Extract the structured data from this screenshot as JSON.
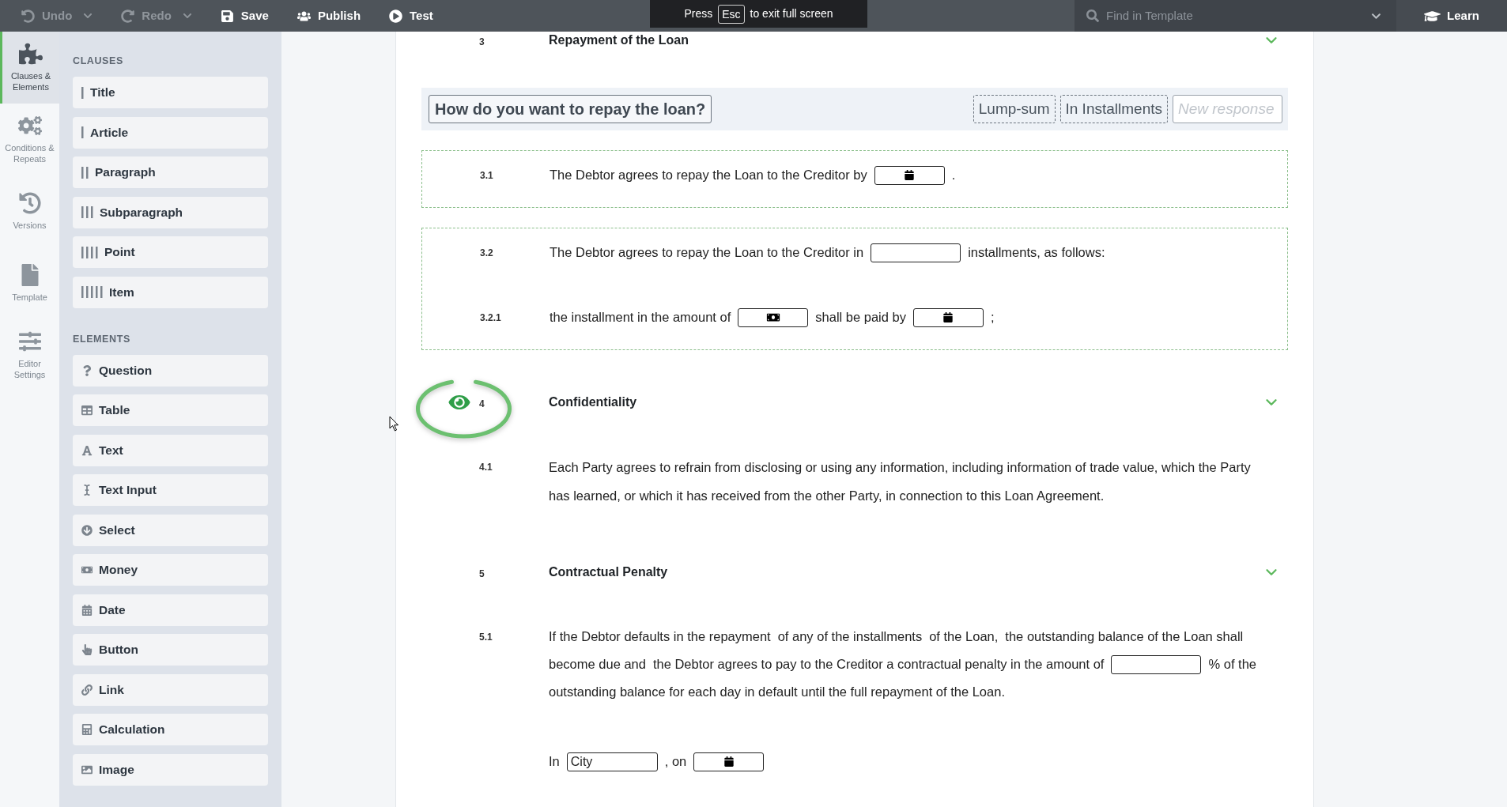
{
  "toolbar": {
    "actions": [
      {
        "kind": "undo",
        "label": "Undo",
        "disabled": true,
        "menu": true
      },
      {
        "kind": "redo",
        "label": "Redo",
        "disabled": true,
        "menu": true
      },
      {
        "kind": "save",
        "label": "Save",
        "disabled": false,
        "menu": false
      },
      {
        "kind": "publish",
        "label": "Publish",
        "disabled": false,
        "menu": false
      },
      {
        "kind": "test",
        "label": "Test",
        "disabled": false,
        "menu": false
      }
    ],
    "search": {
      "placeholder": "Find in Template"
    },
    "learn": {
      "label": "Learn"
    }
  },
  "fullscreen_notice": {
    "before": "Press",
    "key": "Esc",
    "after": "to exit full screen"
  },
  "rail": [
    {
      "kind": "clauses",
      "label": "Clauses & Elements",
      "selected": true
    },
    {
      "kind": "conditions",
      "label": "Conditions & Repeats",
      "selected": false
    },
    {
      "kind": "versions",
      "label": "Versions",
      "selected": false
    },
    {
      "kind": "template",
      "label": "Template",
      "selected": false
    },
    {
      "kind": "settings",
      "label": "Editor Settings",
      "selected": false
    }
  ],
  "palette": [
    {
      "heading": "CLAUSES",
      "items": [
        {
          "kind": "title",
          "label": "Title"
        },
        {
          "kind": "article",
          "label": "Article"
        },
        {
          "kind": "paragraph",
          "label": "Paragraph"
        },
        {
          "kind": "subparagraph",
          "label": "Subparagraph"
        },
        {
          "kind": "point",
          "label": "Point"
        },
        {
          "kind": "item",
          "label": "Item"
        }
      ]
    },
    {
      "heading": "ELEMENTS",
      "items": [
        {
          "kind": "question",
          "label": "Question"
        },
        {
          "kind": "table",
          "label": "Table"
        },
        {
          "kind": "text",
          "label": "Text"
        },
        {
          "kind": "text_input",
          "label": "Text Input"
        },
        {
          "kind": "select",
          "label": "Select"
        },
        {
          "kind": "money",
          "label": "Money"
        },
        {
          "kind": "date",
          "label": "Date"
        },
        {
          "kind": "button",
          "label": "Button"
        },
        {
          "kind": "link",
          "label": "Link"
        },
        {
          "kind": "calculation",
          "label": "Calculation"
        },
        {
          "kind": "image",
          "label": "Image"
        }
      ]
    }
  ],
  "document": {
    "sections": [
      {
        "number": "3",
        "title": "Repayment of the Loan",
        "highlighted": false,
        "items": [
          {
            "kind": "question",
            "text": "How do you want to repay the loan?",
            "options": [
              "Lump-sum",
              "In Installments"
            ],
            "new_response": {
              "placeholder": "New response"
            }
          },
          {
            "kind": "condition_block",
            "paragraphs": [
              {
                "number": "3.1",
                "lines": [
                  [
                    {
                      "kind": "text",
                      "text": "The Debtor agrees to repay the Loan to the Creditor by"
                    },
                    {
                      "kind": "date"
                    },
                    {
                      "kind": "text",
                      "text": "."
                    }
                  ]
                ]
              }
            ]
          },
          {
            "kind": "condition_block",
            "paragraphs": [
              {
                "number": "3.2",
                "lines": [
                  [
                    {
                      "kind": "text",
                      "text": "The Debtor agrees to repay the Loan to the Creditor in"
                    },
                    {
                      "kind": "number"
                    },
                    {
                      "kind": "text",
                      "text": "installments, as follows:"
                    }
                  ]
                ]
              },
              {
                "number": "3.2.1",
                "lines": [
                  [
                    {
                      "kind": "text",
                      "text": "the installment in the amount of"
                    },
                    {
                      "kind": "money"
                    },
                    {
                      "kind": "text",
                      "text": "shall be paid by"
                    },
                    {
                      "kind": "date"
                    },
                    {
                      "kind": "text",
                      "text": ";"
                    }
                  ]
                ]
              }
            ]
          }
        ]
      },
      {
        "number": "4",
        "title": "Confidentiality",
        "highlighted": true,
        "items": [
          {
            "kind": "prose",
            "number": "4.1",
            "text": "Each Party agrees to refrain from disclosing or using any information, including information of trade value, which the Party has learned, or which it has received from the other Party, in connection to this Loan Agreement."
          }
        ]
      },
      {
        "number": "5",
        "title": "Contractual Penalty",
        "highlighted": false,
        "items": [
          {
            "kind": "paragraph",
            "number": "5.1",
            "lines": [
              [
                {
                  "kind": "text",
                  "text": "If the Debtor defaults in the repayment"
                },
                {
                  "kind": "text",
                  "text": "of any of the installments"
                },
                {
                  "kind": "text",
                  "text": "of the Loan,"
                },
                {
                  "kind": "text",
                  "text": "the outstanding balance of the Loan shall"
                }
              ],
              [
                {
                  "kind": "text",
                  "text": "become due and"
                },
                {
                  "kind": "text",
                  "text": "the Debtor agrees to pay to the Creditor a contractual penalty in the amount of"
                },
                {
                  "kind": "number"
                },
                {
                  "kind": "text",
                  "text": "% of the"
                }
              ],
              [
                {
                  "kind": "text",
                  "text": "outstanding balance for each day in default until the full repayment of the Loan."
                }
              ]
            ]
          },
          {
            "kind": "paragraph",
            "lines": [
              [
                {
                  "kind": "text",
                  "text": "In"
                },
                {
                  "kind": "text_input",
                  "value": "City"
                },
                {
                  "kind": "text",
                  "text": ", on"
                },
                {
                  "kind": "date"
                }
              ]
            ]
          }
        ]
      }
    ]
  }
}
